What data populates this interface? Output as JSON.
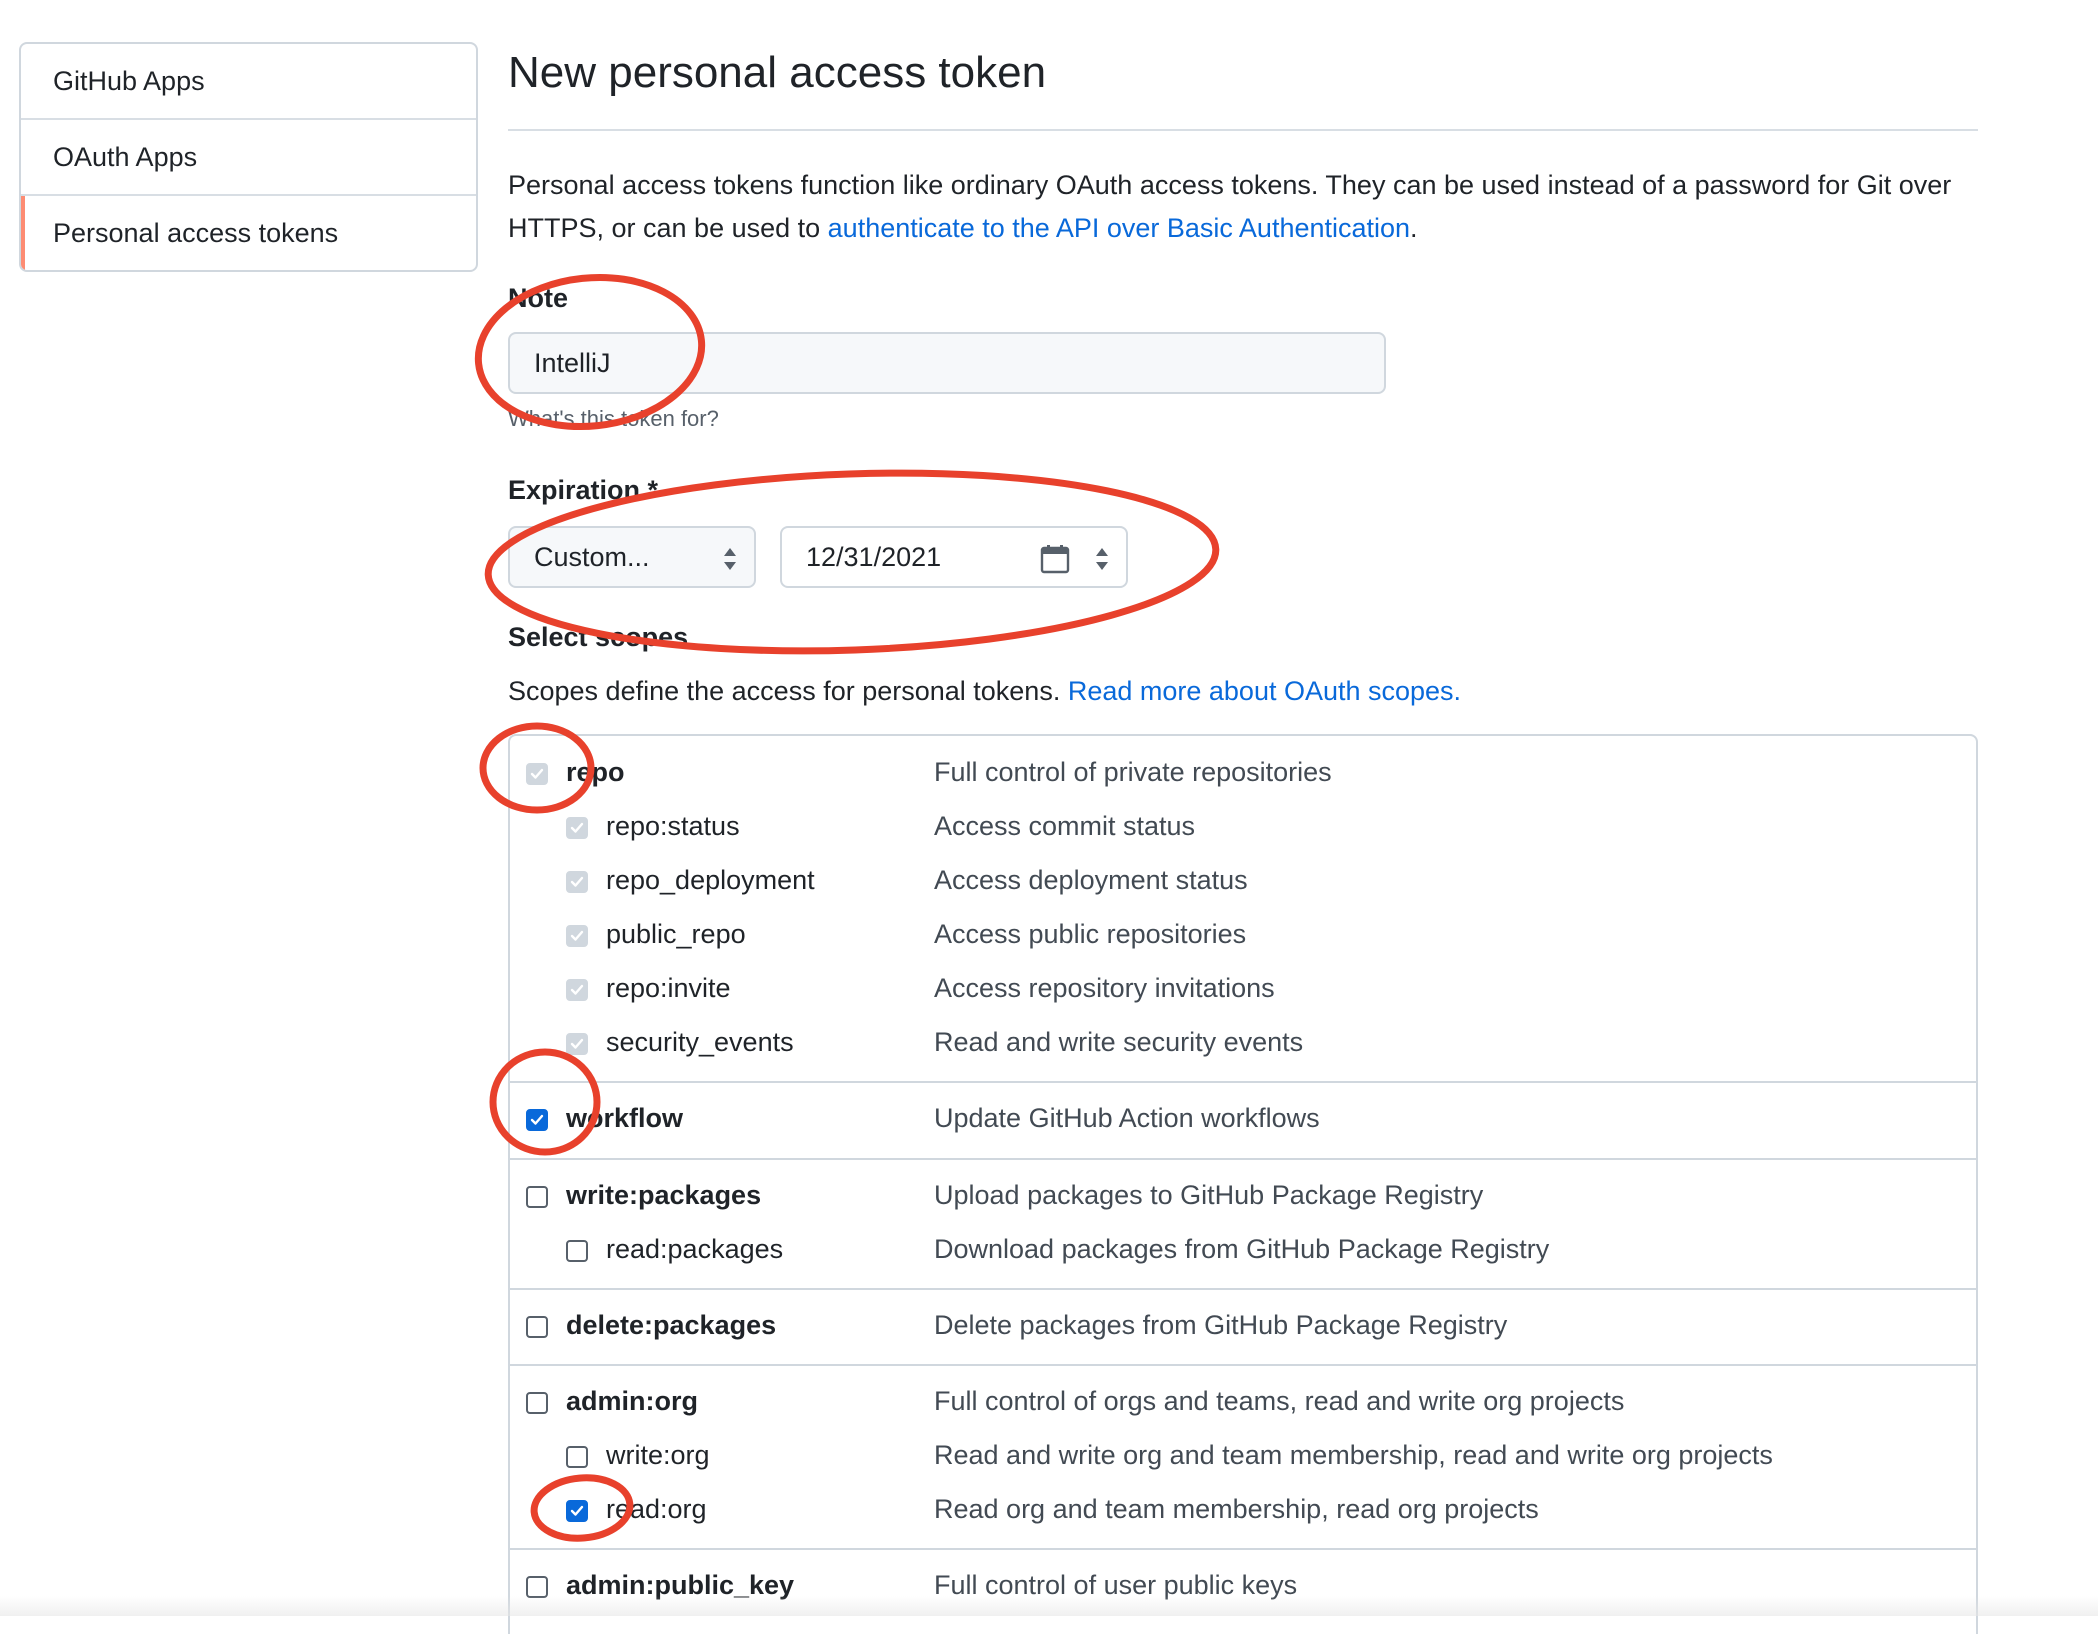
{
  "sidebar": {
    "items": [
      {
        "label": "GitHub Apps"
      },
      {
        "label": "OAuth Apps"
      },
      {
        "label": "Personal access tokens"
      }
    ]
  },
  "header": {
    "title": "New personal access token"
  },
  "intro": {
    "text_before": "Personal access tokens function like ordinary OAuth access tokens. They can be used instead of a password for Git over HTTPS, or can be used to ",
    "link": "authenticate to the API over Basic Authentication",
    "text_after": "."
  },
  "note": {
    "label": "Note",
    "value": "IntelliJ",
    "hint": "What's this token for?"
  },
  "expiration": {
    "label": "Expiration *",
    "select_value": "Custom...",
    "date_value": "12/31/2021"
  },
  "scopes": {
    "label": "Select scopes",
    "description": "Scopes define the access for personal tokens. ",
    "link": "Read more about OAuth scopes.",
    "items": [
      {
        "name": "repo",
        "desc": "Full control of private repositories",
        "state": "disabled-checked"
      },
      {
        "name": "repo:status",
        "desc": "Access commit status",
        "state": "disabled-checked"
      },
      {
        "name": "repo_deployment",
        "desc": "Access deployment status",
        "state": "disabled-checked"
      },
      {
        "name": "public_repo",
        "desc": "Access public repositories",
        "state": "disabled-checked"
      },
      {
        "name": "repo:invite",
        "desc": "Access repository invitations",
        "state": "disabled-checked"
      },
      {
        "name": "security_events",
        "desc": "Read and write security events",
        "state": "disabled-checked"
      },
      {
        "name": "workflow",
        "desc": "Update GitHub Action workflows",
        "state": "checked"
      },
      {
        "name": "write:packages",
        "desc": "Upload packages to GitHub Package Registry",
        "state": "unchecked"
      },
      {
        "name": "read:packages",
        "desc": "Download packages from GitHub Package Registry",
        "state": "unchecked"
      },
      {
        "name": "delete:packages",
        "desc": "Delete packages from GitHub Package Registry",
        "state": "unchecked"
      },
      {
        "name": "admin:org",
        "desc": "Full control of orgs and teams, read and write org projects",
        "state": "unchecked"
      },
      {
        "name": "write:org",
        "desc": "Read and write org and team membership, read and write org projects",
        "state": "unchecked"
      },
      {
        "name": "read:org",
        "desc": "Read org and team membership, read org projects",
        "state": "checked"
      },
      {
        "name": "admin:public_key",
        "desc": "Full control of user public keys",
        "state": "unchecked"
      }
    ]
  },
  "colors": {
    "link": "#0969da",
    "checkbox_checked": "#0969da",
    "annotation": "#e8412c",
    "active_tab": "#fd8c73"
  }
}
